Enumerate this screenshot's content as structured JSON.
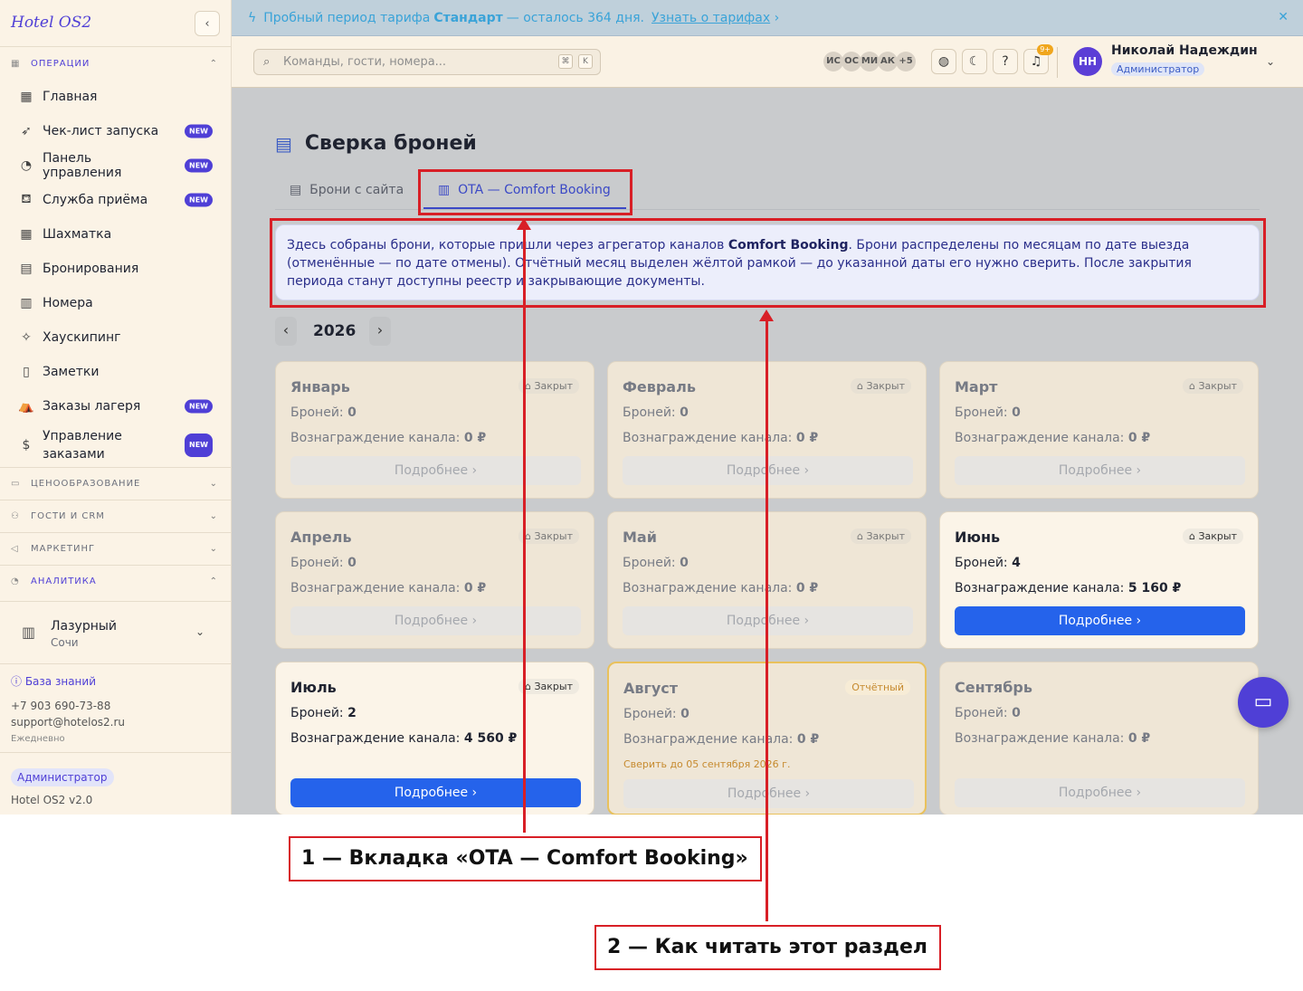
{
  "app": {
    "logo": "Hotel OS2",
    "collapse_icon": "‹"
  },
  "sidebar": {
    "operations_label": "ОПЕРАЦИИ",
    "items": [
      {
        "label": "Главная",
        "icon": "▦",
        "icon_name": "dashboard-icon",
        "new": ""
      },
      {
        "label": "Чек-лист запуска",
        "icon": "➶",
        "icon_name": "rocket-icon",
        "new": "NEW"
      },
      {
        "label": "Панель управления",
        "icon": "◔",
        "icon_name": "gauge-icon",
        "new": "NEW"
      },
      {
        "label": "Служба приёма",
        "icon": "⛾",
        "icon_name": "bell-desk-icon",
        "new": "NEW"
      },
      {
        "label": "Шахматка",
        "icon": "▦",
        "icon_name": "grid-icon",
        "new": ""
      },
      {
        "label": "Бронирования",
        "icon": "▤",
        "icon_name": "clipboard-icon",
        "new": ""
      },
      {
        "label": "Номера",
        "icon": "▥",
        "icon_name": "building-icon",
        "new": ""
      },
      {
        "label": "Хаускипинг",
        "icon": "✧",
        "icon_name": "sparkles-icon",
        "new": ""
      },
      {
        "label": "Заметки",
        "icon": "▯",
        "icon_name": "note-icon",
        "new": ""
      },
      {
        "label": "Заказы лагеря",
        "icon": "⛺",
        "icon_name": "tent-icon",
        "new": "NEW"
      },
      {
        "label": "Управление заказами",
        "icon": "$",
        "icon_name": "dollar-icon",
        "new": "NEW"
      }
    ],
    "sections": [
      {
        "label": "ЦЕНООБРАЗОВАНИЕ",
        "icon": "▭",
        "icon_name": "card-icon"
      },
      {
        "label": "ГОСТИ И CRM",
        "icon": "⚇",
        "icon_name": "users-icon"
      },
      {
        "label": "МАРКЕТИНГ",
        "icon": "◁",
        "icon_name": "megaphone-icon"
      },
      {
        "label": "АНАЛИТИКА",
        "icon": "◔",
        "icon_name": "chart-icon"
      }
    ],
    "hotel": {
      "name": "Лазурный",
      "city": "Сочи"
    },
    "help": {
      "kb": "База знаний",
      "phone": "+7 903 690-73-88",
      "email": "support@hotelos2.ru",
      "schedule": "Ежедневно"
    },
    "footer": {
      "role": "Администратор",
      "version": "Hotel OS2 v2.0"
    }
  },
  "trial": {
    "prefix": "Пробный период тарифа",
    "plan": "Стандарт",
    "suffix": "— осталось 364 дня.",
    "link": "Узнать о тарифах",
    "close": "✕"
  },
  "topbar": {
    "search_placeholder": "Команды, гости, номера...",
    "kbd1": "⌘",
    "kbd2": "K",
    "avatars": [
      "ИС",
      "ОС",
      "МИ",
      "АК",
      "+5"
    ],
    "notif_count": "9+",
    "user": {
      "initials": "НН",
      "name": "Николай Надеждин",
      "role": "Администратор"
    }
  },
  "page": {
    "title": "Сверка броней",
    "tabs": [
      "Брони с сайта",
      "OTA — Comfort Booking"
    ],
    "info": {
      "p1": "Здесь собраны брони, которые пришли через агрегатор каналов ",
      "b1": "Comfort Booking",
      "p2": ". Брони распределены по месяцам по дате выезда (отменённые — по дате отмены). Отчётный месяц выделен жёлтой рамкой — до указанной даты его нужно сверить. После закрытия периода станут доступны реестр и закрывающие документы."
    },
    "year": "2026",
    "labels": {
      "bookings": "Броней:",
      "commission": "Вознаграждение канала:",
      "more": "Подробнее"
    },
    "months": [
      {
        "name": "Январь",
        "status": "Закрыт",
        "count": "0",
        "commission": "0 ₽",
        "deadline": ""
      },
      {
        "name": "Февраль",
        "status": "Закрыт",
        "count": "0",
        "commission": "0 ₽",
        "deadline": ""
      },
      {
        "name": "Март",
        "status": "Закрыт",
        "count": "0",
        "commission": "0 ₽",
        "deadline": ""
      },
      {
        "name": "Апрель",
        "status": "Закрыт",
        "count": "0",
        "commission": "0 ₽",
        "deadline": ""
      },
      {
        "name": "Май",
        "status": "Закрыт",
        "count": "0",
        "commission": "0 ₽",
        "deadline": ""
      },
      {
        "name": "Июнь",
        "status": "Закрыт",
        "count": "4",
        "commission": "5 160 ₽",
        "deadline": ""
      },
      {
        "name": "Июль",
        "status": "Закрыт",
        "count": "2",
        "commission": "4 560 ₽",
        "deadline": ""
      },
      {
        "name": "Август",
        "status": "Отчётный",
        "count": "0",
        "commission": "0 ₽",
        "deadline": "Сверить до 05 сентября 2026 г."
      },
      {
        "name": "Сентябрь",
        "status": "",
        "count": "0",
        "commission": "0 ₽",
        "deadline": ""
      }
    ]
  },
  "annotations": {
    "c1": "1 — Вкладка «OTA — Comfort Booking»",
    "c2": "2 — Как читать этот раздел"
  }
}
